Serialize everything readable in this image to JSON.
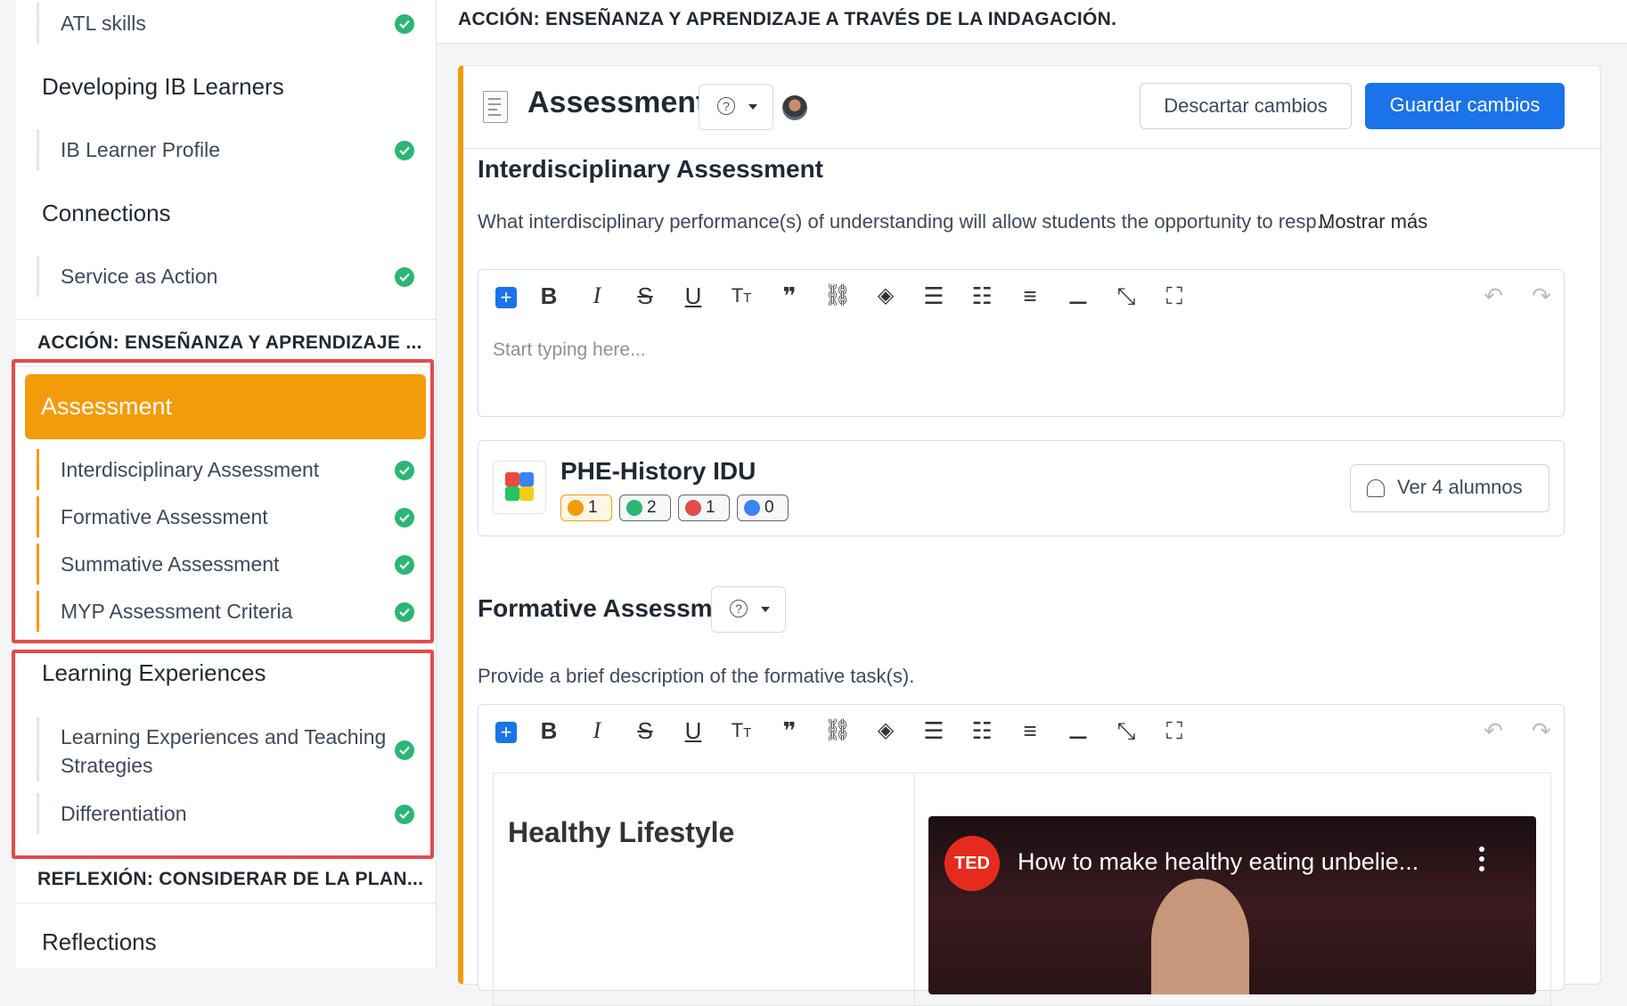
{
  "sidebar": {
    "items": [
      {
        "label": "ATL skills"
      },
      {
        "title": "Developing IB Learners"
      },
      {
        "label": "IB Learner Profile"
      },
      {
        "title": "Connections"
      },
      {
        "label": "Service as Action"
      }
    ],
    "section_accion": "ACCIÓN: ENSEÑANZA Y APRENDIZAJE ...",
    "active_item": "Assessment",
    "assessment_children": [
      "Interdisciplinary Assessment",
      "Formative Assessment",
      "Summative Assessment",
      "MYP Assessment Criteria"
    ],
    "learning_title": "Learning Experiences",
    "learning_children": [
      "Learning Experiences and Teaching Strategies",
      "Differentiation"
    ],
    "section_reflexion": "REFLEXIÓN: CONSIDERAR DE LA PLAN...",
    "reflections_title": "Reflections"
  },
  "main": {
    "topbar_title": "ACCIÓN: ENSEÑANZA Y APRENDIZAJE A TRAVÉS DE LA INDAGACIÓN.",
    "card_title": "Assessment",
    "discard_label": "Descartar cambios",
    "save_label": "Guardar cambios",
    "interdisciplinary": {
      "heading": "Interdisciplinary Assessment",
      "prompt": "What interdisciplinary performance(s) of understanding will allow students the opportunity to resp...",
      "show_more": "Mostrar más",
      "placeholder": "Start typing here..."
    },
    "group": {
      "name": "PHE-History IDU",
      "badges": [
        "1",
        "2",
        "1",
        "0"
      ],
      "view_students": "Ver 4 alumnos"
    },
    "formative": {
      "heading": "Formative Assessment",
      "prompt": "Provide a brief description of the formative task(s).",
      "content_title": "Healthy Lifestyle",
      "video_title": "How to make healthy eating unbelie...",
      "ted_logo": "TED"
    }
  },
  "colors": {
    "accent": "#f39c0b",
    "primary": "#1a73e8",
    "success": "#2bb673",
    "highlight": "#e24c4b"
  }
}
